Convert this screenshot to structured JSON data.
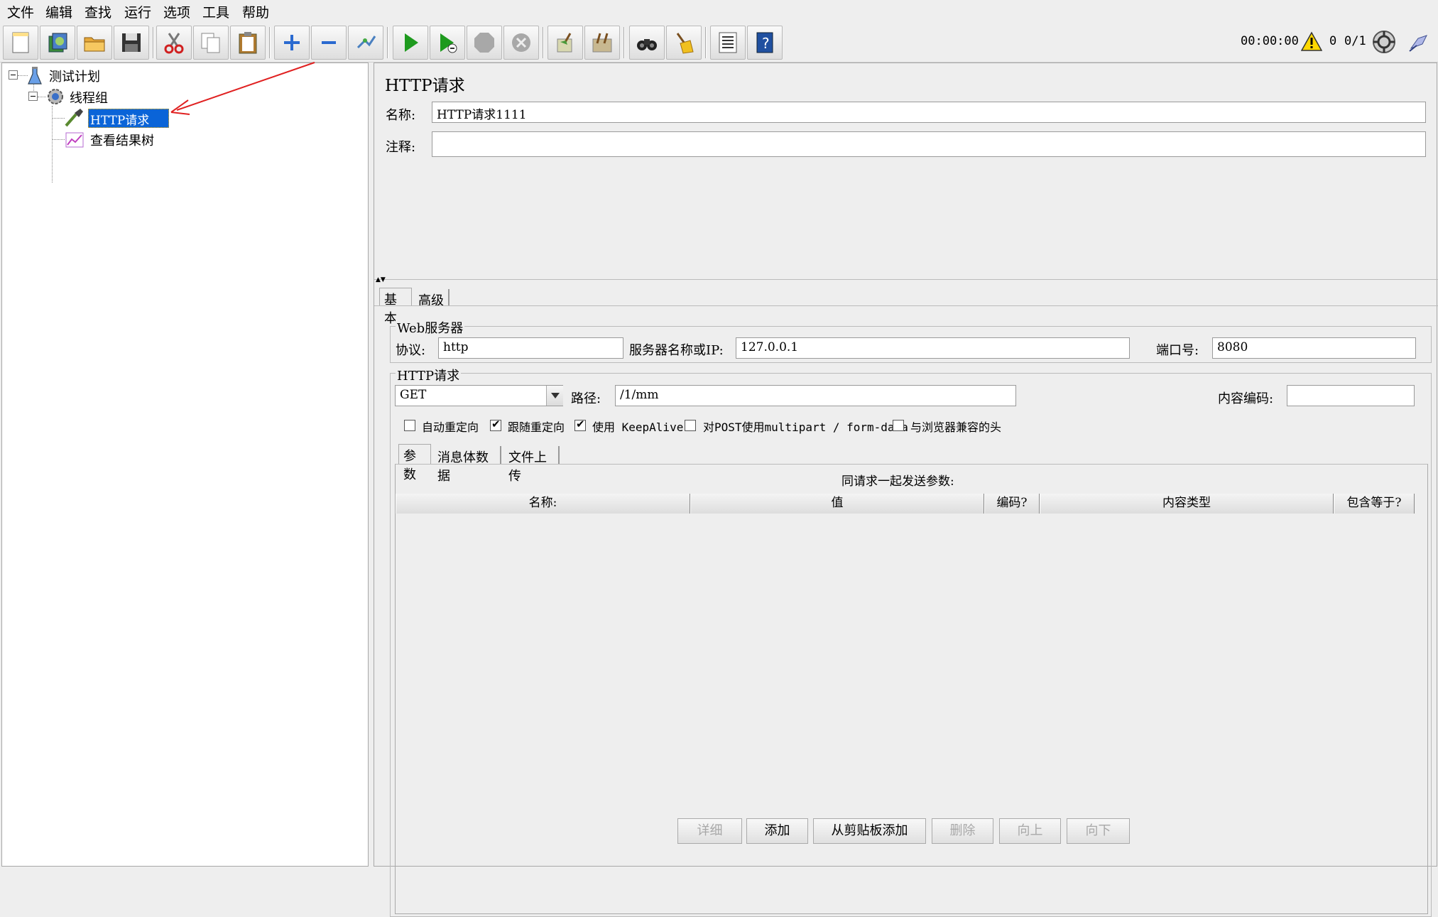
{
  "menubar": {
    "items": [
      "文件",
      "编辑",
      "查找",
      "运行",
      "选项",
      "工具",
      "帮助"
    ]
  },
  "toolbar": {
    "icons": [
      "new-icon",
      "templates-icon",
      "open-icon",
      "save-icon",
      "cut-icon",
      "copy-icon",
      "paste-icon",
      "expand-icon",
      "collapse-icon",
      "toggle-icon",
      "start-icon",
      "start-no-pauses-icon",
      "stop-icon",
      "shutdown-icon",
      "clear-icon",
      "clear-all-icon",
      "search-icon",
      "reset-search-icon",
      "function-helper-icon",
      "help-icon"
    ],
    "timer": "00:00:00",
    "warning_count": "0",
    "threads": "0/1"
  },
  "tree": {
    "root": "测试计划",
    "thread_group": "线程组",
    "http_request": "HTTP请求1111",
    "listener": "查看结果树"
  },
  "panel": {
    "title": "HTTP请求",
    "name_label": "名称:",
    "name_value": "HTTP请求1111",
    "comment_label": "注释:",
    "comment_value": ""
  },
  "tabs": {
    "basic": "基本",
    "advanced": "高级"
  },
  "web_server": {
    "title": "Web服务器",
    "protocol_label": "协议:",
    "protocol_value": "http",
    "server_label": "服务器名称或IP:",
    "server_value": "127.0.0.1",
    "port_label": "端口号:",
    "port_value": "8080"
  },
  "http_request": {
    "title": "HTTP请求",
    "method": "GET",
    "path_label": "路径:",
    "path_value": "/1/mm",
    "encoding_label": "内容编码:",
    "encoding_value": "",
    "checkboxes": [
      {
        "label": "自动重定向",
        "checked": false
      },
      {
        "label": "跟随重定向",
        "checked": true
      },
      {
        "label": "使用 KeepAlive",
        "checked": true
      },
      {
        "label": "对POST使用multipart / form-data",
        "checked": false
      },
      {
        "label": "与浏览器兼容的头",
        "checked": false
      }
    ]
  },
  "subtabs": {
    "params": "参数",
    "body": "消息体数据",
    "files": "文件上传"
  },
  "params_table": {
    "caption": "同请求一起发送参数:",
    "columns": [
      "名称:",
      "值",
      "编码?",
      "内容类型",
      "包含等于?"
    ]
  },
  "buttons": {
    "detail": "详细",
    "add": "添加",
    "add_clipboard": "从剪贴板添加",
    "delete": "删除",
    "up": "向上",
    "down": "向下"
  },
  "colors": {
    "selection": "#0a64d8",
    "arrow": "#e02020",
    "green": "#1e9a1e"
  }
}
